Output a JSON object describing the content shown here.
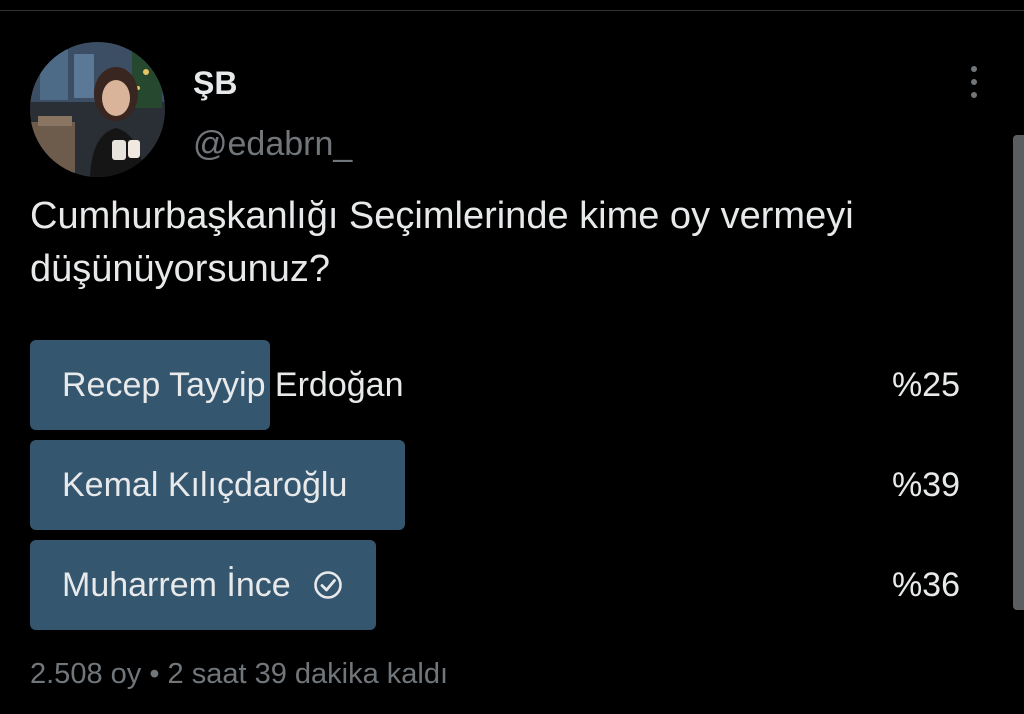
{
  "user": {
    "display_name": "ŞB",
    "handle": "@edabrn_"
  },
  "tweet": {
    "text": "Cumhurbaşkanlığı Seçimlerinde kime oy vermeyi düşünüyorsunuz?"
  },
  "poll": {
    "options": [
      {
        "label": "Recep Tayyip Erdoğan",
        "percent_label": "%25",
        "percent": 25,
        "selected": false
      },
      {
        "label": "Kemal Kılıçdaroğlu",
        "percent_label": "%39",
        "percent": 39,
        "selected": false
      },
      {
        "label": "Muharrem İnce",
        "percent_label": "%36",
        "percent": 36,
        "selected": true
      }
    ],
    "footer": {
      "votes": "2.508 oy",
      "separator": "•",
      "time_left": "2 saat 39 dakika kaldı"
    }
  },
  "colors": {
    "background": "#000000",
    "poll_fill": "#35566f",
    "text_primary": "#e7e9ea",
    "text_secondary": "#71767b"
  },
  "icons": {
    "more": "more-vertical-icon",
    "selected": "check-circle-icon"
  }
}
